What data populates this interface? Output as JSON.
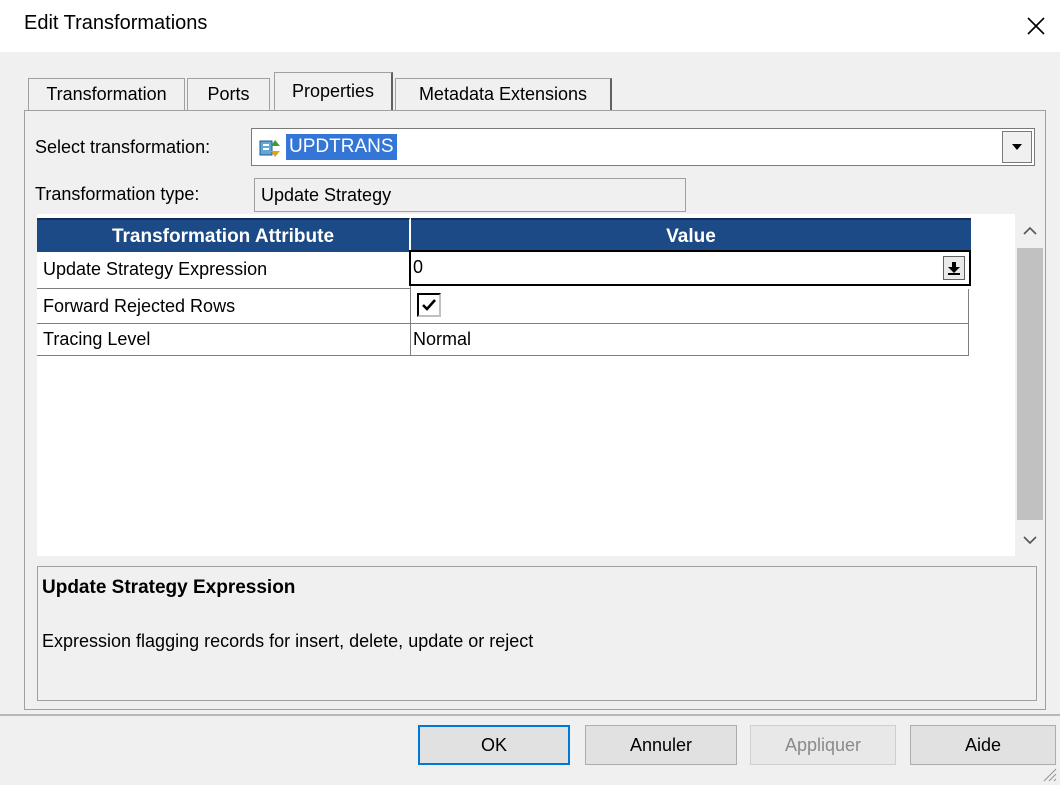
{
  "window": {
    "title": "Edit Transformations"
  },
  "tabs": [
    {
      "label": "Transformation"
    },
    {
      "label": "Ports"
    },
    {
      "label": "Properties"
    },
    {
      "label": "Metadata Extensions"
    }
  ],
  "select_transformation": {
    "label": "Select transformation:",
    "value": "UPDTRANS"
  },
  "transformation_type": {
    "label": "Transformation type:",
    "value": "Update Strategy"
  },
  "grid": {
    "headers": [
      "Transformation Attribute",
      "Value"
    ],
    "rows": [
      {
        "attribute": "Update Strategy Expression",
        "value": "0"
      },
      {
        "attribute": "Forward Rejected Rows",
        "checked": true
      },
      {
        "attribute": "Tracing Level",
        "value": "Normal"
      }
    ]
  },
  "description": {
    "title": "Update Strategy Expression",
    "text": "Expression flagging records for insert, delete, update or reject"
  },
  "buttons": {
    "ok": "OK",
    "cancel": "Annuler",
    "apply": "Appliquer",
    "help": "Aide"
  },
  "colors": {
    "header_bg": "#1c4a86",
    "selection": "#3376d6",
    "default_button_border": "#0078d7"
  }
}
